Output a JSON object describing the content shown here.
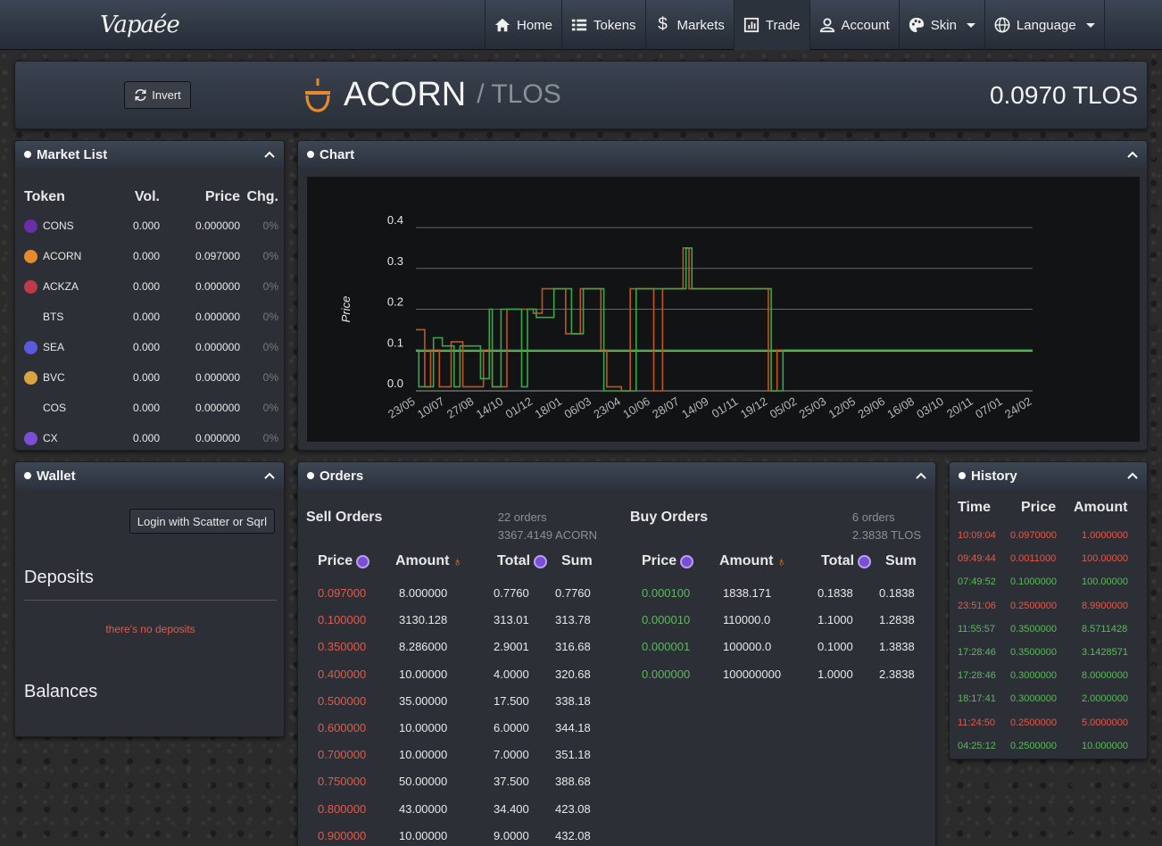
{
  "nav": {
    "logo": "Vapaée",
    "items": [
      {
        "label": "Home",
        "icon": "home-icon"
      },
      {
        "label": "Tokens",
        "icon": "list-icon"
      },
      {
        "label": "Markets",
        "icon": "dollar-icon"
      },
      {
        "label": "Trade",
        "icon": "chart-icon",
        "active": true
      },
      {
        "label": "Account",
        "icon": "user-icon"
      },
      {
        "label": "Skin",
        "icon": "palette-icon",
        "dropdown": true
      },
      {
        "label": "Language",
        "icon": "globe-icon",
        "dropdown": true
      }
    ]
  },
  "header": {
    "invert_label": "Invert",
    "token": "ACORN",
    "quote": "/ TLOS",
    "price": "0.0970 TLOS"
  },
  "market_list": {
    "title": "Market List",
    "columns": [
      "Token",
      "Vol.",
      "Price",
      "Chg."
    ],
    "rows": [
      {
        "token": "CONS",
        "vol": "0.000",
        "price": "0.000000",
        "chg": "0%",
        "color": "#6a2fa8"
      },
      {
        "token": "ACORN",
        "vol": "0.000",
        "price": "0.097000",
        "chg": "0%",
        "color": "#e8892b"
      },
      {
        "token": "ACKZA",
        "vol": "0.000",
        "price": "0.000000",
        "chg": "0%",
        "color": "#c0394b"
      },
      {
        "token": "BTS",
        "vol": "0.000",
        "price": "0.000000",
        "chg": "0%",
        "color": "#2c3036"
      },
      {
        "token": "SEA",
        "vol": "0.000",
        "price": "0.000000",
        "chg": "0%",
        "color": "#5a5ae0"
      },
      {
        "token": "BVC",
        "vol": "0.000",
        "price": "0.000000",
        "chg": "0%",
        "color": "#d9a441"
      },
      {
        "token": "COS",
        "vol": "0.000",
        "price": "0.000000",
        "chg": "0%",
        "color": "#2c3036"
      },
      {
        "token": "CX",
        "vol": "0.000",
        "price": "0.000000",
        "chg": "0%",
        "color": "#7b4ed8"
      }
    ]
  },
  "chart_panel": {
    "title": "Chart",
    "ylabel": "Price"
  },
  "chart_data": {
    "type": "line",
    "ylabel": "Price",
    "ylim": [
      0,
      0.4
    ],
    "yticks": [
      "0.0",
      "0.1",
      "0.2",
      "0.3",
      "0.4"
    ],
    "xticks": [
      "23/05",
      "10/07",
      "27/08",
      "14/10",
      "01/12",
      "18/01",
      "06/03",
      "23/04",
      "10/06",
      "28/07",
      "14/09",
      "01/11",
      "19/12",
      "05/02",
      "25/03",
      "12/05",
      "29/06",
      "16/08",
      "03/10",
      "20/11",
      "07/01",
      "24/02"
    ],
    "grid": true,
    "reference_lines": [
      0.097,
      0.1
    ],
    "series": [
      {
        "color": "#c0561f",
        "x": [
          0,
          0.3,
          0.3,
          0.5,
          0.5,
          0.8,
          0.8,
          1.2,
          1.2,
          1.6,
          1.6,
          2.3,
          2.3,
          2.6,
          2.6,
          3.1,
          3.1,
          4.0,
          4.0,
          4.3,
          4.3,
          5.1,
          5.1,
          5.6,
          5.6,
          6.3,
          6.3,
          6.5,
          6.5,
          7.0,
          7.0,
          7.3,
          7.3,
          8.1,
          8.1,
          8.4,
          8.4,
          9.1,
          9.1,
          9.3,
          9.3,
          12.0,
          12.0,
          12.3,
          12.3,
          21.0
        ],
        "y": [
          0.15,
          0.15,
          0.01,
          0.01,
          0.1,
          0.1,
          0.01,
          0.01,
          0.12,
          0.12,
          0.01,
          0.01,
          0.1,
          0.1,
          0.01,
          0.01,
          0.2,
          0.2,
          0.19,
          0.19,
          0.25,
          0.25,
          0.14,
          0.14,
          0.25,
          0.25,
          0.1,
          0.1,
          0.01,
          0.01,
          0.0,
          0.0,
          0.25,
          0.25,
          0.0,
          0.0,
          0.25,
          0.25,
          0.35,
          0.35,
          0.25,
          0.25,
          0.0,
          0.0,
          0.1,
          0.1
        ]
      },
      {
        "color": "#3aa64a",
        "x": [
          0,
          0.1,
          0.1,
          0.6,
          0.6,
          0.9,
          0.9,
          1.3,
          1.3,
          1.5,
          1.5,
          2.2,
          2.2,
          2.5,
          2.5,
          2.6,
          2.6,
          2.9,
          2.9,
          3.6,
          3.6,
          3.8,
          3.8,
          4.1,
          4.1,
          4.7,
          4.7,
          5.3,
          5.3,
          5.7,
          5.7,
          6.4,
          6.4,
          7.5,
          7.5,
          9.2,
          9.2,
          9.4,
          9.4,
          12.1,
          12.1,
          12.5,
          12.5,
          21.0
        ],
        "y": [
          0.1,
          0.1,
          0.01,
          0.01,
          0.13,
          0.13,
          0.11,
          0.11,
          0.01,
          0.01,
          0.11,
          0.11,
          0.03,
          0.03,
          0.2,
          0.2,
          0.01,
          0.01,
          0.2,
          0.2,
          0.01,
          0.01,
          0.2,
          0.2,
          0.18,
          0.18,
          0.25,
          0.25,
          0.14,
          0.14,
          0.25,
          0.25,
          0.0,
          0.0,
          0.25,
          0.25,
          0.35,
          0.35,
          0.25,
          0.25,
          0.0,
          0.0,
          0.1,
          0.1
        ]
      }
    ]
  },
  "wallet": {
    "title": "Wallet",
    "login_label": "Login with Scatter or Sqrl",
    "deposits_title": "Deposits",
    "deposits_empty": "there's no deposits",
    "balances_title": "Balances"
  },
  "orders": {
    "title": "Orders",
    "sell": {
      "title": "Sell Orders",
      "count": "22 orders",
      "total": "3367.4149 ACORN",
      "columns": [
        "Price",
        "Amount",
        "Total",
        "Sum"
      ],
      "rows": [
        [
          "0.097000",
          "8.000000",
          "0.7760",
          "0.7760"
        ],
        [
          "0.100000",
          "3130.128",
          "313.01",
          "313.78"
        ],
        [
          "0.350000",
          "8.286000",
          "2.9001",
          "316.68"
        ],
        [
          "0.400000",
          "10.00000",
          "4.0000",
          "320.68"
        ],
        [
          "0.500000",
          "35.00000",
          "17.500",
          "338.18"
        ],
        [
          "0.600000",
          "10.00000",
          "6.0000",
          "344.18"
        ],
        [
          "0.700000",
          "10.00000",
          "7.0000",
          "351.18"
        ],
        [
          "0.750000",
          "50.00000",
          "37.500",
          "388.68"
        ],
        [
          "0.800000",
          "43.00000",
          "34.400",
          "423.08"
        ],
        [
          "0.900000",
          "10.00000",
          "9.0000",
          "432.08"
        ]
      ]
    },
    "buy": {
      "title": "Buy Orders",
      "count": "6 orders",
      "total": "2.3838 TLOS",
      "columns": [
        "Price",
        "Amount",
        "Total",
        "Sum"
      ],
      "rows": [
        [
          "0.000100",
          "1838.171",
          "0.1838",
          "0.1838"
        ],
        [
          "0.000010",
          "110000.0",
          "1.1000",
          "1.2838"
        ],
        [
          "0.000001",
          "100000.0",
          "0.1000",
          "1.3838"
        ],
        [
          "0.000000",
          "100000000",
          "1.0000",
          "2.3838"
        ]
      ]
    }
  },
  "history": {
    "title": "History",
    "columns": [
      "Time",
      "Price",
      "Amount"
    ],
    "rows": [
      {
        "time": "10:09:04",
        "price": "0.0970000",
        "amount": "1.0000000",
        "side": "sell"
      },
      {
        "time": "09:49:44",
        "price": "0.0011000",
        "amount": "100.00000",
        "side": "sell"
      },
      {
        "time": "07:49:52",
        "price": "0.1000000",
        "amount": "100.00000",
        "side": "buy"
      },
      {
        "time": "23:51:06",
        "price": "0.2500000",
        "amount": "8.9900000",
        "side": "sell"
      },
      {
        "time": "11:55:57",
        "price": "0.3500000",
        "amount": "8.5711428",
        "side": "buy"
      },
      {
        "time": "17:28:46",
        "price": "0.3500000",
        "amount": "3.1428571",
        "side": "buy"
      },
      {
        "time": "17:28:46",
        "price": "0.3000000",
        "amount": "8.0000000",
        "side": "buy"
      },
      {
        "time": "18:17:41",
        "price": "0.3000000",
        "amount": "2.0000000",
        "side": "buy"
      },
      {
        "time": "11:24:50",
        "price": "0.2500000",
        "amount": "5.0000000",
        "side": "sell"
      },
      {
        "time": "04:25:12",
        "price": "0.2500000",
        "amount": "10.000000",
        "side": "buy"
      }
    ]
  }
}
